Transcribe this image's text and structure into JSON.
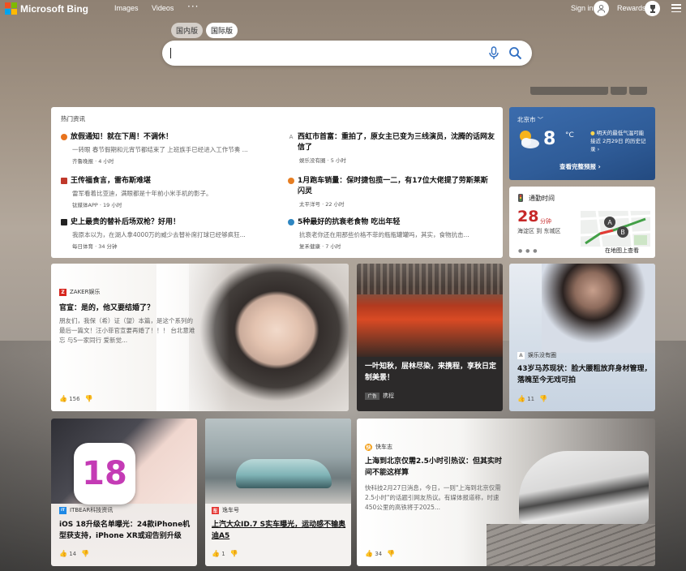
{
  "header": {
    "logo_text": "Microsoft Bing",
    "nav": [
      "Images",
      "Videos"
    ],
    "more": "···",
    "signin": "Sign in",
    "rewards": "Rewards"
  },
  "tabs": [
    {
      "label": "国内版",
      "active": false
    },
    {
      "label": "国际版",
      "active": true
    }
  ],
  "search": {
    "value": ""
  },
  "hot_news": {
    "title": "热门资讯",
    "items": [
      {
        "title": "放假通知！就在下周！不调休！",
        "snippet": "一转眼 春节假期和元宵节都结束了 上班族手已经进入工作节奏 ...",
        "meta": "齐鲁晚报 · 4 小时",
        "color": "#e8731e"
      },
      {
        "title": "西虹市首富：重拍了，原女主已变为三线演员，沈腾的话网友信了",
        "snippet": "",
        "meta": "娱乐没有圈 · 5 小时",
        "color": "#7a7a7a"
      },
      {
        "title": "王传福食言，雷布斯难堪",
        "snippet": "雷军看着比亚迪，满眼都是十年前小米手机的影子。",
        "meta": "钛媒体APP · 19 小时",
        "color": "#c0392b"
      },
      {
        "title": "1月跑车销量：保时捷包揽一二，有17位大佬提了劳斯莱斯闪灵",
        "snippet": "",
        "meta": "太平洋号 · 22 小时",
        "color": "#e67e22"
      },
      {
        "title": "史上最贵的替补后场双枪？好用！",
        "snippet": "我原本以为，在湖人拿4000万的威少去替补席打球已经够疯狂...",
        "meta": "每日体育 · 34 分钟",
        "color": "#222222"
      },
      {
        "title": "5种最好的抗衰老食物 吃出年轻",
        "snippet": "抗衰老你还在用那些价格不菲的瓶瓶罐罐吗，其实，食物抗击...",
        "meta": "复禾健康 · 7 小时",
        "color": "#2e86c1"
      }
    ]
  },
  "weather": {
    "city": "北京市",
    "temp": "8",
    "unit": "°C",
    "info": "明天的最低气温可能接近 2月29日 的历史记录",
    "link": "查看完整预报"
  },
  "commute": {
    "title": "通勤时间",
    "minutes": "28",
    "min_label": "分钟",
    "route": "海淀区 到 东城区",
    "map_link": "在地图上查看",
    "map_a": "A",
    "map_b": "B"
  },
  "cards": [
    {
      "source": "ZAKER娱乐",
      "badge": "Z",
      "badge_color": "#d7261e",
      "title": "官宣：是的，他又要结婚了？",
      "snippet": "朋友们，我保（希）证（望）本篇，是这个系列的最后一篇文！汪小菲官宣要再婚了！！！ 台北意难忘 与S一家同行 爱新觉...",
      "likes": "156"
    },
    {
      "source": "携程",
      "badge": "广告",
      "title": "一叶知秋，层林尽染，来携程，享秋日定制美景！",
      "snippet": "",
      "likes": ""
    },
    {
      "source": "娱乐没有圈",
      "badge": "A",
      "badge_color": "#888888",
      "title": "43岁马苏现状：脸大腰粗放弃身材管理，落魄至今无戏可拍",
      "snippet": "",
      "likes": "11"
    },
    {
      "source": "ITBEAR科技资讯",
      "badge": "IT",
      "badge_color": "#1e88e5",
      "title": "iOS 18升级名单曝光：24款iPhone机型获支持，iPhone XR或迎告别升级",
      "snippet": "",
      "likes": "14"
    },
    {
      "source": "逸车号",
      "badge": "车",
      "badge_color": "#e53935",
      "title": "上汽大众ID.7 S实车曝光，运动感不输奥迪A5",
      "snippet": "",
      "likes": "1"
    },
    {
      "source": "快车志",
      "badge": "快",
      "badge_color": "#f39c12",
      "title": "上海到北京仅需2.5小时引热议：但其实时间不能这样算",
      "snippet": "快科技2月27日消息，今日，一则\"上海到北京仅需2.5小时\"的话题引网友热议。有媒体报道称，时速450公里的高铁将于2025...",
      "likes": "34"
    }
  ],
  "ios_badge": "18"
}
